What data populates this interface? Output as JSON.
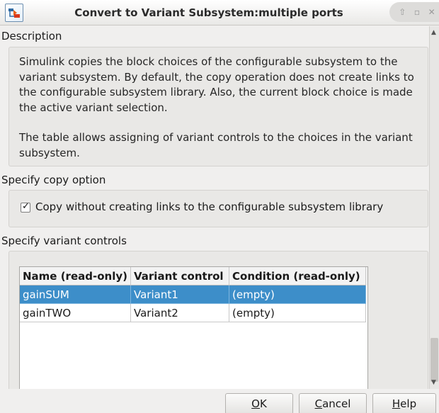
{
  "window": {
    "title": "Convert to Variant Subsystem:multiple ports",
    "controls": [
      "⇧",
      "▫",
      "✕"
    ]
  },
  "description": {
    "label": "Description",
    "paragraph1": "Simulink copies the block choices of the configurable subsystem to the variant subsystem. By default, the copy operation does not create links to the configurable subsystem library. Also, the current block choice is made the active variant selection.",
    "paragraph2": "The table allows assigning of variant controls to the choices in the variant subsystem."
  },
  "copy_option": {
    "label": "Specify copy option",
    "checkbox_label": "Copy without creating links to the configurable subsystem library",
    "checked": true
  },
  "variant_controls": {
    "label": "Specify variant controls",
    "columns": [
      "Name (read-only)",
      "Variant control",
      "Condition (read-only)"
    ],
    "rows": [
      [
        "gainSUM",
        "Variant1",
        "(empty)"
      ],
      [
        "gainTWO",
        "Variant2",
        "(empty)"
      ]
    ],
    "selected_row": 0
  },
  "buttons": {
    "ok": {
      "mnemonic": "O",
      "rest": "K"
    },
    "cancel": {
      "mnemonic": "C",
      "rest": "ancel"
    },
    "help": {
      "mnemonic": "H",
      "rest": "elp"
    }
  },
  "colors": {
    "selection": "#3d8ec9",
    "background": "#f0efee"
  }
}
